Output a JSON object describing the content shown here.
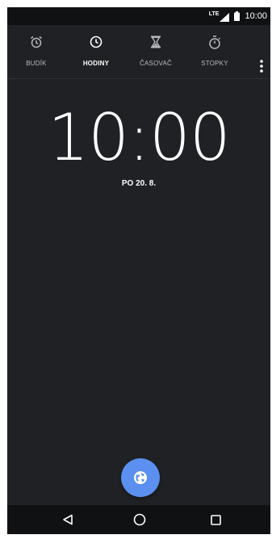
{
  "status_bar": {
    "network": "LTE",
    "time": "10:00",
    "icons": [
      "signal-icon",
      "battery-icon"
    ]
  },
  "tabs": [
    {
      "label": "BUDÍK",
      "icon": "alarm-icon",
      "active": false
    },
    {
      "label": "HODINY",
      "icon": "clock-icon",
      "active": true
    },
    {
      "label": "ČASOVAČ",
      "icon": "hourglass-icon",
      "active": false
    },
    {
      "label": "STOPKY",
      "icon": "stopwatch-icon",
      "active": false
    }
  ],
  "clock": {
    "time": "10:00",
    "date": "PO 20. 8."
  },
  "fab": {
    "icon": "globe-icon"
  },
  "nav": {
    "icons": [
      "back-icon",
      "home-icon",
      "recents-icon"
    ]
  },
  "colors": {
    "background": "#202124",
    "status_bar": "#101113",
    "accent": "#5b8ff0",
    "text": "#ffffff",
    "muted_text": "#b7b9bd"
  }
}
